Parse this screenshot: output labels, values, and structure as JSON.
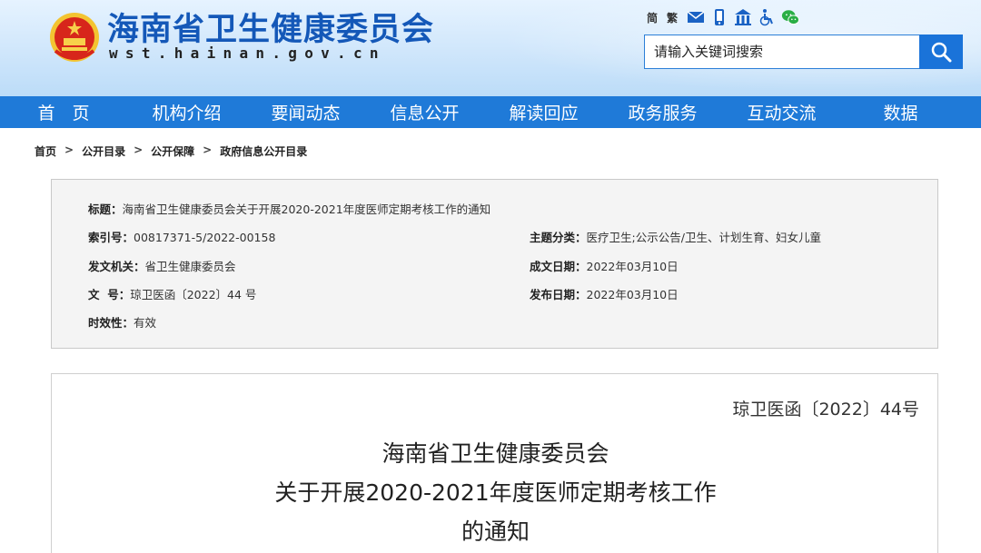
{
  "header": {
    "site_title": "海南省卫生健康委员会",
    "site_domain": "wst.hainan.gov.cn",
    "lang_simplified": "简",
    "lang_traditional": "繁",
    "top_icons": [
      "mail-icon",
      "mobile-icon",
      "accessibility-building-icon",
      "wheelchair-icon",
      "wechat-icon"
    ],
    "search_placeholder": "请输入关键词搜索",
    "brand_color": "#1f7ad8"
  },
  "nav": {
    "items": [
      "首　页",
      "机构介绍",
      "要闻动态",
      "信息公开",
      "解读回应",
      "政务服务",
      "互动交流",
      "数据"
    ]
  },
  "breadcrumb": [
    "首页",
    "公开目录",
    "公开保障",
    "政府信息公开目录"
  ],
  "breadcrumb_sep": ">",
  "meta": {
    "title_label": "标题：",
    "title_value": "海南省卫生健康委员会关于开展2020-2021年度医师定期考核工作的通知",
    "index_label": "索引号：",
    "index_value": "00817371-5/2022-00158",
    "topic_label": "主题分类：",
    "topic_value": "医疗卫生;公示公告/卫生、计划生育、妇女儿童",
    "issuer_label": "发文机关：",
    "issuer_value": "省卫生健康委员会",
    "created_label": "成文日期：",
    "created_value": "2022年03月10日",
    "docno_label": "文  号：",
    "docno_value": "琼卫医函〔2022〕44 号",
    "published_label": "发布日期：",
    "published_value": "2022年03月10日",
    "validity_label": "时效性：",
    "validity_value": "有效"
  },
  "document": {
    "doc_number": "琼卫医函〔2022〕44号",
    "title_line1": "海南省卫生健康委员会",
    "title_line2": "关于开展2020-2021年度医师定期考核工作",
    "title_line3": "的通知"
  }
}
